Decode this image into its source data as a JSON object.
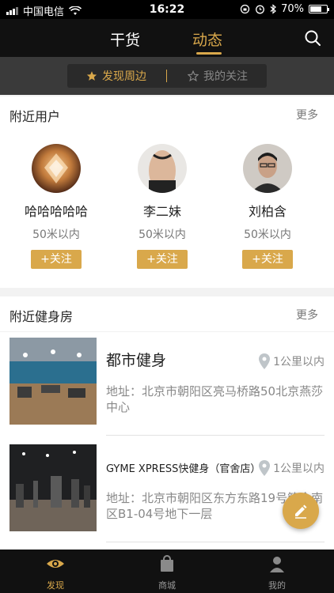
{
  "status_bar": {
    "carrier": "中国电信",
    "time": "16:22",
    "battery": "70%",
    "battery_level": 0.7
  },
  "header": {
    "tabs": [
      {
        "label": "干货"
      },
      {
        "label": "动态"
      }
    ],
    "active_tab": 1
  },
  "segment": {
    "items": [
      {
        "label": "发现周边"
      },
      {
        "label": "我的关注"
      }
    ],
    "active": 0
  },
  "colors": {
    "accent": "#d9a84b",
    "header_bg": "#111111",
    "segment_bg": "#3a3a3a"
  },
  "nearby_users": {
    "title": "附近用户",
    "more": "更多",
    "users": [
      {
        "name": "哈哈哈哈哈",
        "distance": "50米以内",
        "follow": "+关注"
      },
      {
        "name": "李二妹",
        "distance": "50米以内",
        "follow": "+关注"
      },
      {
        "name": "刘柏含",
        "distance": "50米以内",
        "follow": "+关注"
      }
    ]
  },
  "nearby_gyms": {
    "title": "附近健身房",
    "more": "更多",
    "gyms": [
      {
        "name": "都市健身",
        "distance": "1公里以内",
        "address": "地址：北京市朝阳区亮马桥路50北京燕莎中心"
      },
      {
        "name": "GYME XPRESS快健身（官舍店）",
        "distance": "1公里以内",
        "address": "地址：北京市朝阳区东方东路19号管舍南区B1-04号地下一层"
      }
    ]
  },
  "tabbar": {
    "items": [
      {
        "label": "发现",
        "icon": "eye-icon"
      },
      {
        "label": "商城",
        "icon": "bag-icon"
      },
      {
        "label": "我的",
        "icon": "person-icon"
      }
    ],
    "active": 0
  }
}
